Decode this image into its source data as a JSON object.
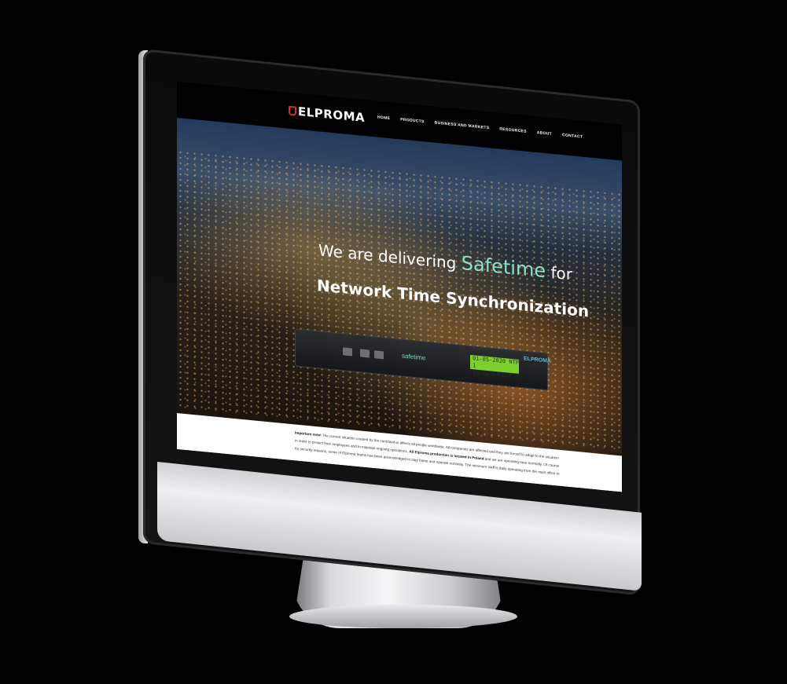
{
  "nav": {
    "logo_text": "ELPROMA",
    "items": [
      "HOME",
      "PRODUCTS",
      "BUSINESS AND MARKETS",
      "RESOURCES",
      "ABOUT",
      "CONTACT"
    ]
  },
  "hero": {
    "line1_prefix": "We are delivering",
    "brand": "Safetime",
    "line1_suffix": "for",
    "line2": "Network Time Synchronization"
  },
  "device": {
    "brand": "safetime",
    "logo": "ELPROMA",
    "lcd_line1": "01-05-2020 NTP 1",
    "lcd_line2": "13:46:44  DCF 1"
  },
  "notice": {
    "label": "Important note!",
    "text1": "The current situation created by the coronavirus affects all people worldwide. All companies are affected and they are forced to adapt to the situation",
    "text2": "in order to protect their employees and to maintain ongoing operations.",
    "bold2": "All Elproma production is located in Poland",
    "text2b": "and we are operating near normally. Of course",
    "text3": "for security reasons, some of Elproma teams has been acknowledged to stay home and operate remotely. The minimum staff is daily operating from the main office to"
  },
  "colors": {
    "accent": "#e0282d",
    "brand_green": "#8fe0c8"
  }
}
